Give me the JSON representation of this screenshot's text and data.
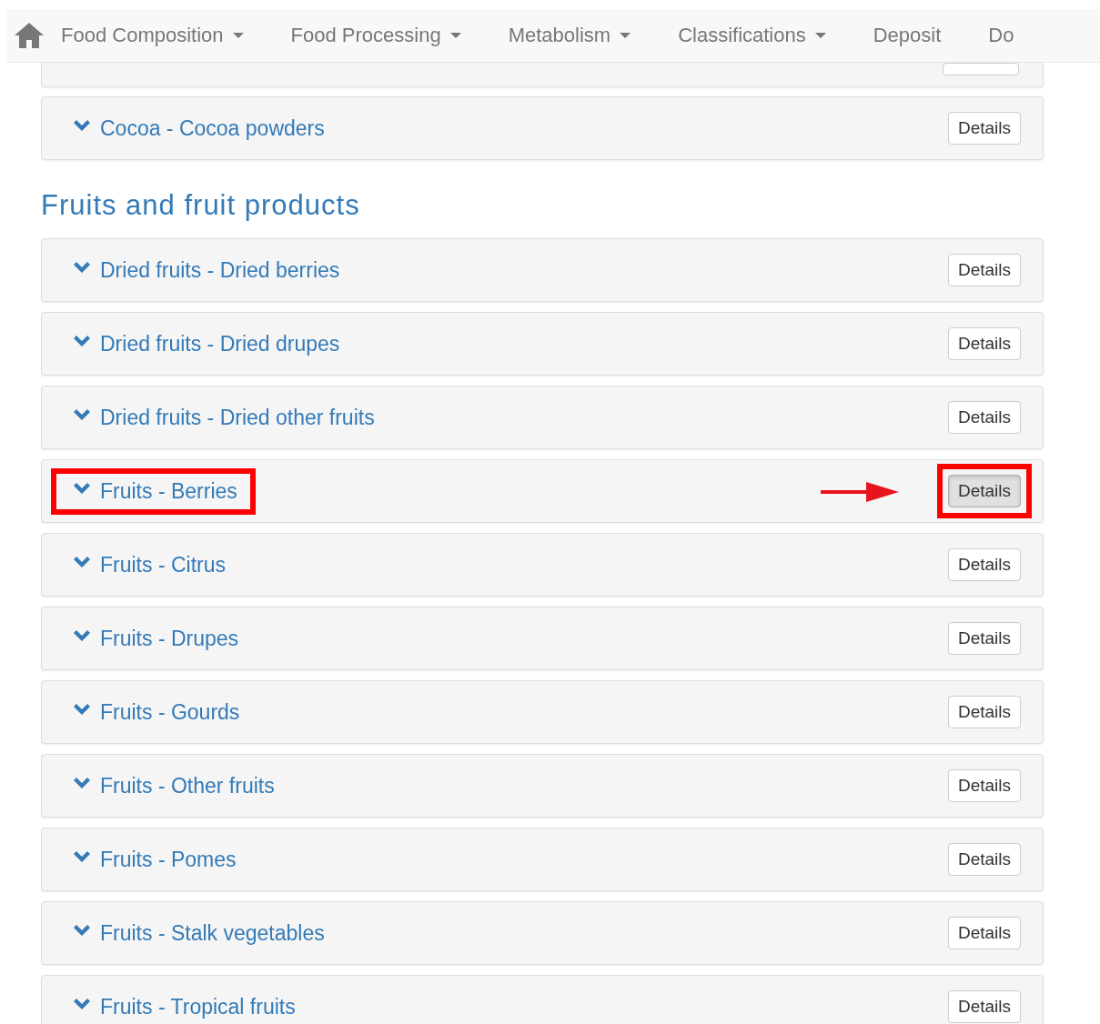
{
  "navbar": {
    "items": [
      {
        "label": "Food Composition",
        "dropdown": true
      },
      {
        "label": "Food Processing",
        "dropdown": true
      },
      {
        "label": "Metabolism",
        "dropdown": true
      },
      {
        "label": "Classifications",
        "dropdown": true
      },
      {
        "label": "Deposit",
        "dropdown": false
      },
      {
        "label": "Do",
        "dropdown": false
      }
    ]
  },
  "sections": [
    {
      "panels": [
        {
          "kind": "stub"
        },
        {
          "kind": "panel",
          "title": "Cocoa - Cocoa powders",
          "button": "Details",
          "highlighted": false,
          "pressed": false
        }
      ]
    },
    {
      "heading": "Fruits and fruit products",
      "panels": [
        {
          "kind": "panel",
          "title": "Dried fruits - Dried berries",
          "button": "Details",
          "highlighted": false,
          "pressed": false
        },
        {
          "kind": "panel",
          "title": "Dried fruits - Dried drupes",
          "button": "Details",
          "highlighted": false,
          "pressed": false
        },
        {
          "kind": "panel",
          "title": "Dried fruits - Dried other fruits",
          "button": "Details",
          "highlighted": false,
          "pressed": false
        },
        {
          "kind": "panel",
          "title": "Fruits - Berries",
          "button": "Details",
          "highlighted": true,
          "pressed": true
        },
        {
          "kind": "panel",
          "title": "Fruits - Citrus",
          "button": "Details",
          "highlighted": false,
          "pressed": false
        },
        {
          "kind": "panel",
          "title": "Fruits - Drupes",
          "button": "Details",
          "highlighted": false,
          "pressed": false
        },
        {
          "kind": "panel",
          "title": "Fruits - Gourds",
          "button": "Details",
          "highlighted": false,
          "pressed": false
        },
        {
          "kind": "panel",
          "title": "Fruits - Other fruits",
          "button": "Details",
          "highlighted": false,
          "pressed": false
        },
        {
          "kind": "panel",
          "title": "Fruits - Pomes",
          "button": "Details",
          "highlighted": false,
          "pressed": false
        },
        {
          "kind": "panel",
          "title": "Fruits - Stalk vegetables",
          "button": "Details",
          "highlighted": false,
          "pressed": false
        },
        {
          "kind": "panel",
          "title": "Fruits - Tropical fruits",
          "button": "Details",
          "highlighted": false,
          "pressed": false
        }
      ]
    }
  ]
}
